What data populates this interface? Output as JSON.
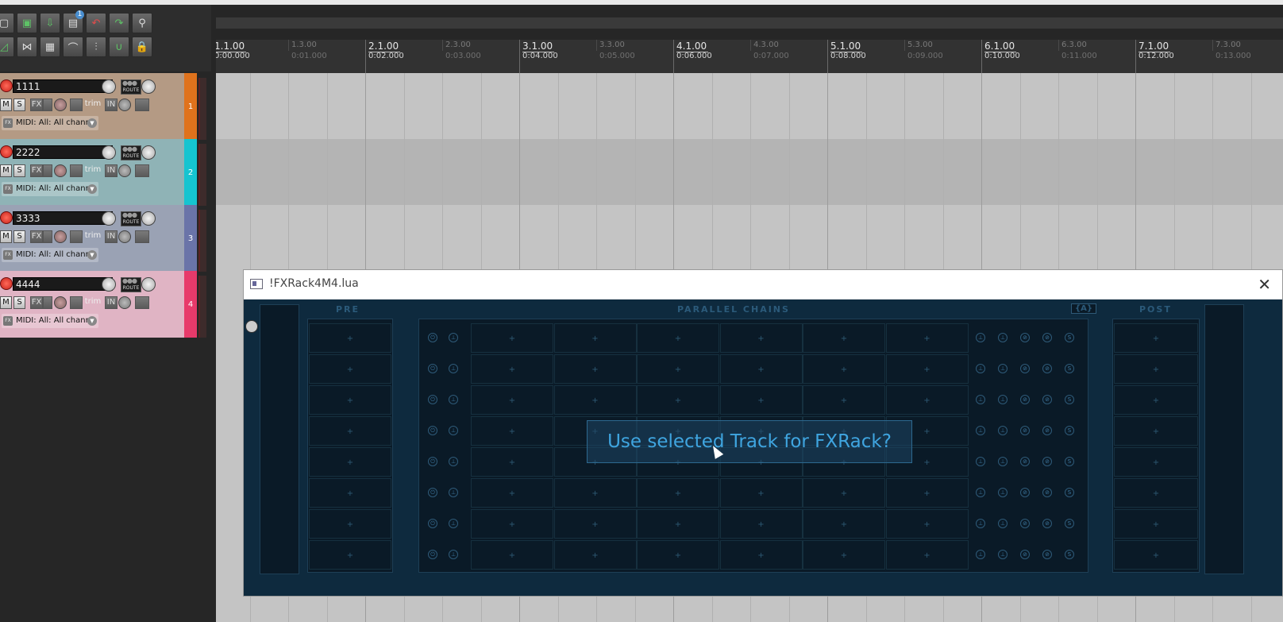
{
  "toolbar": {
    "icons": [
      "new-project-icon",
      "save-icon",
      "open-icon",
      "project-tab-icon",
      "undo-icon",
      "redo-icon",
      "metronome-icon",
      "envelope-icon",
      "ripple-icon",
      "grid-icon",
      "snap-icon",
      "auto-crossfade-icon",
      "magnet-icon",
      "lock-icon"
    ],
    "tab_count": "1"
  },
  "ruler": {
    "marks": [
      {
        "beat": "1.1.00",
        "time": "0:00.000",
        "major": true
      },
      {
        "beat": "1.3.00",
        "time": "0:01.000",
        "major": false
      },
      {
        "beat": "2.1.00",
        "time": "0:02.000",
        "major": true
      },
      {
        "beat": "2.3.00",
        "time": "0:03.000",
        "major": false
      },
      {
        "beat": "3.1.00",
        "time": "0:04.000",
        "major": true
      },
      {
        "beat": "3.3.00",
        "time": "0:05.000",
        "major": false
      },
      {
        "beat": "4.1.00",
        "time": "0:06.000",
        "major": true
      },
      {
        "beat": "4.3.00",
        "time": "0:07.000",
        "major": false
      },
      {
        "beat": "5.1.00",
        "time": "0:08.000",
        "major": true
      },
      {
        "beat": "5.3.00",
        "time": "0:09.000",
        "major": false
      },
      {
        "beat": "6.1.00",
        "time": "0:10.000",
        "major": true
      },
      {
        "beat": "6.3.00",
        "time": "0:11.000",
        "major": false
      },
      {
        "beat": "7.1.00",
        "time": "0:12.000",
        "major": true
      },
      {
        "beat": "7.3.00",
        "time": "0:13.000",
        "major": false
      }
    ]
  },
  "tracks": [
    {
      "name": "1111",
      "number": "1",
      "color": "#b49a84",
      "numcolor": "#e0721c",
      "lane": "#c4c4c4"
    },
    {
      "name": "2222",
      "number": "2",
      "color": "#8fb3b6",
      "numcolor": "#16c4d0",
      "lane": "#b4b4b4"
    },
    {
      "name": "3333",
      "number": "3",
      "color": "#9aa2b4",
      "numcolor": "#6a74a8",
      "lane": "#c4c4c4"
    },
    {
      "name": "4444",
      "number": "4",
      "color": "#e0b4c4",
      "numcolor": "#e83a6a",
      "lane": "#c4c4c4"
    }
  ],
  "track_controls": {
    "mute": "M",
    "solo": "S",
    "fx": "FX",
    "trim": "trim",
    "input": "IN",
    "route": "ROUTE",
    "midi_label": "MIDI: All: All chann"
  },
  "dialog": {
    "title": "!FXRack4M4.lua",
    "close": "✕",
    "sections": {
      "pre": "PRE",
      "parallel": "PARALLEL CHAINS",
      "badge": "{A}",
      "post": "POST"
    },
    "prompt": "Use selected Track for FXRack?"
  }
}
